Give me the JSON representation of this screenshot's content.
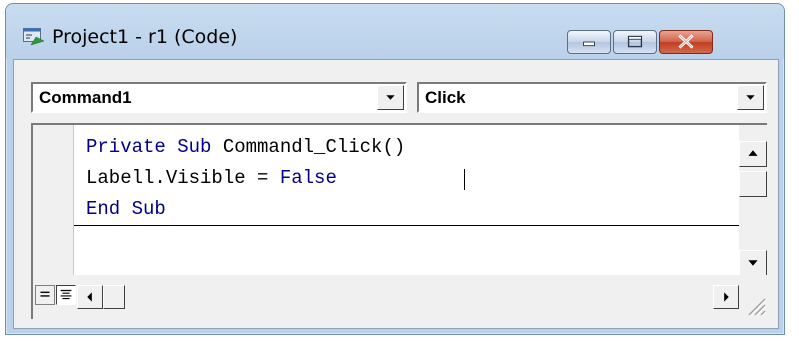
{
  "window": {
    "title": "Project1 - r1 (Code)",
    "icons": {
      "app": "vb-code-window-icon",
      "minimize": "minimize-icon",
      "maximize": "maximize-icon",
      "close": "close-icon"
    }
  },
  "toolbar": {
    "object_combo": {
      "value": "Command1",
      "icon": "dropdown-arrow-icon"
    },
    "procedure_combo": {
      "value": "Click",
      "icon": "dropdown-arrow-icon"
    }
  },
  "code": {
    "lines": [
      {
        "keyword": "Private Sub ",
        "text": "Commandl_Click()"
      },
      {
        "text": "Labell.Visible = ",
        "keyword": "False"
      },
      {
        "keyword": "End Sub"
      }
    ]
  },
  "scrollbars": {
    "icons": {
      "up": "arrow-up-icon",
      "down": "arrow-down-icon",
      "left": "arrow-left-icon",
      "right": "arrow-right-icon"
    }
  },
  "view_buttons": {
    "procedure_view": "procedure-view-icon",
    "full_module_view": "full-module-view-icon"
  },
  "colors": {
    "keyword": "#00008b",
    "text": "#000000",
    "titlebar": "#b9d1ea",
    "close_button": "#c23d1f"
  }
}
